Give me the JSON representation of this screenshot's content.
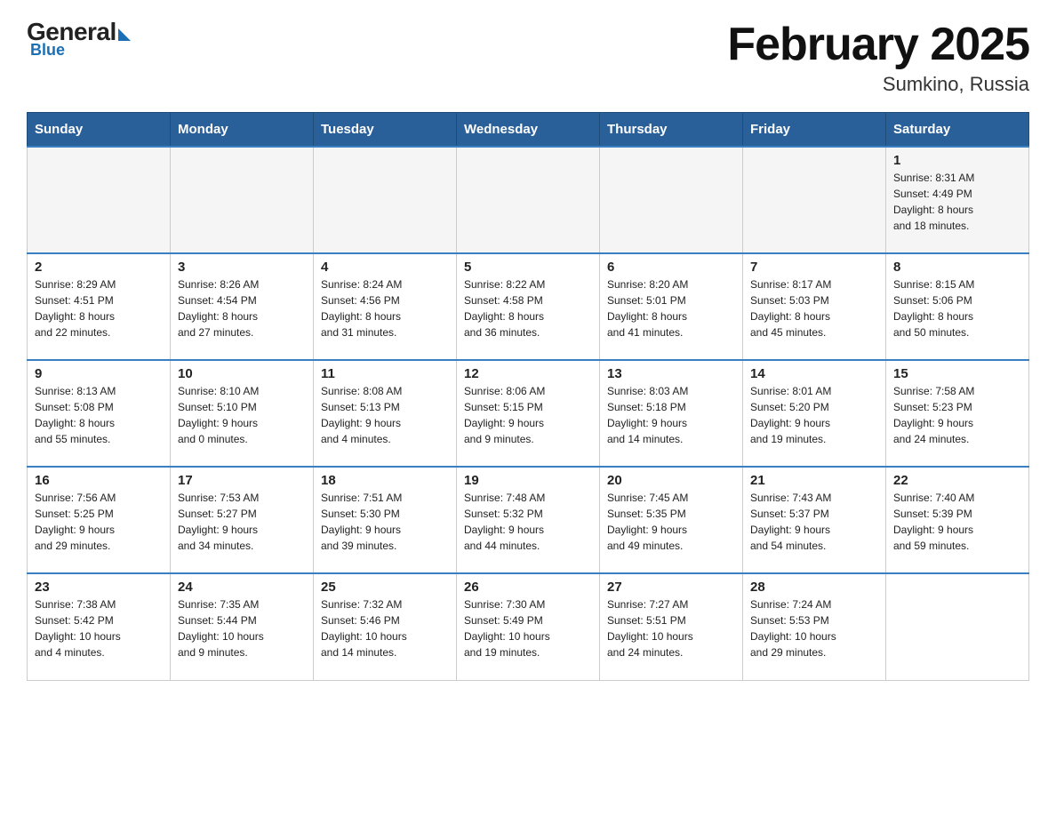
{
  "header": {
    "title": "February 2025",
    "subtitle": "Sumkino, Russia"
  },
  "logo": {
    "general": "General",
    "blue": "Blue"
  },
  "days": [
    "Sunday",
    "Monday",
    "Tuesday",
    "Wednesday",
    "Thursday",
    "Friday",
    "Saturday"
  ],
  "weeks": [
    [
      {
        "day": "",
        "info": ""
      },
      {
        "day": "",
        "info": ""
      },
      {
        "day": "",
        "info": ""
      },
      {
        "day": "",
        "info": ""
      },
      {
        "day": "",
        "info": ""
      },
      {
        "day": "",
        "info": ""
      },
      {
        "day": "1",
        "info": "Sunrise: 8:31 AM\nSunset: 4:49 PM\nDaylight: 8 hours\nand 18 minutes."
      }
    ],
    [
      {
        "day": "2",
        "info": "Sunrise: 8:29 AM\nSunset: 4:51 PM\nDaylight: 8 hours\nand 22 minutes."
      },
      {
        "day": "3",
        "info": "Sunrise: 8:26 AM\nSunset: 4:54 PM\nDaylight: 8 hours\nand 27 minutes."
      },
      {
        "day": "4",
        "info": "Sunrise: 8:24 AM\nSunset: 4:56 PM\nDaylight: 8 hours\nand 31 minutes."
      },
      {
        "day": "5",
        "info": "Sunrise: 8:22 AM\nSunset: 4:58 PM\nDaylight: 8 hours\nand 36 minutes."
      },
      {
        "day": "6",
        "info": "Sunrise: 8:20 AM\nSunset: 5:01 PM\nDaylight: 8 hours\nand 41 minutes."
      },
      {
        "day": "7",
        "info": "Sunrise: 8:17 AM\nSunset: 5:03 PM\nDaylight: 8 hours\nand 45 minutes."
      },
      {
        "day": "8",
        "info": "Sunrise: 8:15 AM\nSunset: 5:06 PM\nDaylight: 8 hours\nand 50 minutes."
      }
    ],
    [
      {
        "day": "9",
        "info": "Sunrise: 8:13 AM\nSunset: 5:08 PM\nDaylight: 8 hours\nand 55 minutes."
      },
      {
        "day": "10",
        "info": "Sunrise: 8:10 AM\nSunset: 5:10 PM\nDaylight: 9 hours\nand 0 minutes."
      },
      {
        "day": "11",
        "info": "Sunrise: 8:08 AM\nSunset: 5:13 PM\nDaylight: 9 hours\nand 4 minutes."
      },
      {
        "day": "12",
        "info": "Sunrise: 8:06 AM\nSunset: 5:15 PM\nDaylight: 9 hours\nand 9 minutes."
      },
      {
        "day": "13",
        "info": "Sunrise: 8:03 AM\nSunset: 5:18 PM\nDaylight: 9 hours\nand 14 minutes."
      },
      {
        "day": "14",
        "info": "Sunrise: 8:01 AM\nSunset: 5:20 PM\nDaylight: 9 hours\nand 19 minutes."
      },
      {
        "day": "15",
        "info": "Sunrise: 7:58 AM\nSunset: 5:23 PM\nDaylight: 9 hours\nand 24 minutes."
      }
    ],
    [
      {
        "day": "16",
        "info": "Sunrise: 7:56 AM\nSunset: 5:25 PM\nDaylight: 9 hours\nand 29 minutes."
      },
      {
        "day": "17",
        "info": "Sunrise: 7:53 AM\nSunset: 5:27 PM\nDaylight: 9 hours\nand 34 minutes."
      },
      {
        "day": "18",
        "info": "Sunrise: 7:51 AM\nSunset: 5:30 PM\nDaylight: 9 hours\nand 39 minutes."
      },
      {
        "day": "19",
        "info": "Sunrise: 7:48 AM\nSunset: 5:32 PM\nDaylight: 9 hours\nand 44 minutes."
      },
      {
        "day": "20",
        "info": "Sunrise: 7:45 AM\nSunset: 5:35 PM\nDaylight: 9 hours\nand 49 minutes."
      },
      {
        "day": "21",
        "info": "Sunrise: 7:43 AM\nSunset: 5:37 PM\nDaylight: 9 hours\nand 54 minutes."
      },
      {
        "day": "22",
        "info": "Sunrise: 7:40 AM\nSunset: 5:39 PM\nDaylight: 9 hours\nand 59 minutes."
      }
    ],
    [
      {
        "day": "23",
        "info": "Sunrise: 7:38 AM\nSunset: 5:42 PM\nDaylight: 10 hours\nand 4 minutes."
      },
      {
        "day": "24",
        "info": "Sunrise: 7:35 AM\nSunset: 5:44 PM\nDaylight: 10 hours\nand 9 minutes."
      },
      {
        "day": "25",
        "info": "Sunrise: 7:32 AM\nSunset: 5:46 PM\nDaylight: 10 hours\nand 14 minutes."
      },
      {
        "day": "26",
        "info": "Sunrise: 7:30 AM\nSunset: 5:49 PM\nDaylight: 10 hours\nand 19 minutes."
      },
      {
        "day": "27",
        "info": "Sunrise: 7:27 AM\nSunset: 5:51 PM\nDaylight: 10 hours\nand 24 minutes."
      },
      {
        "day": "28",
        "info": "Sunrise: 7:24 AM\nSunset: 5:53 PM\nDaylight: 10 hours\nand 29 minutes."
      },
      {
        "day": "",
        "info": ""
      }
    ]
  ]
}
